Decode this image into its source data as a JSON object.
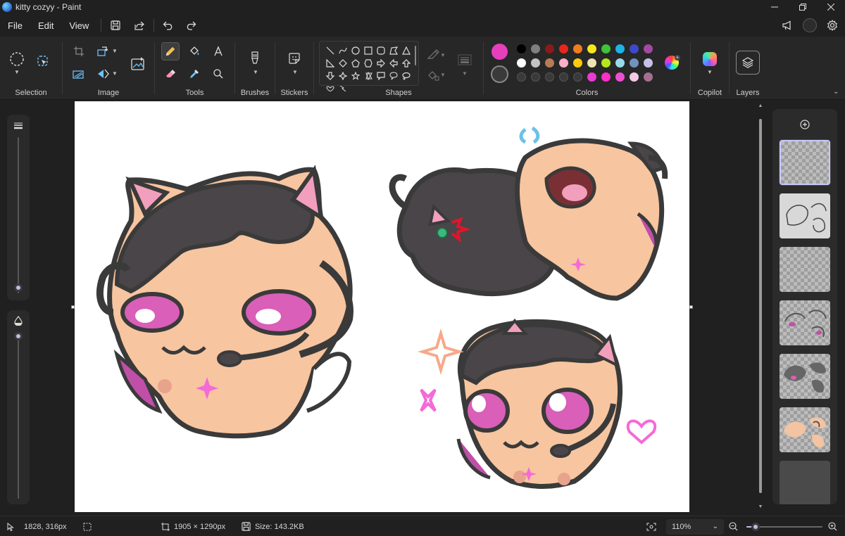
{
  "window": {
    "title": "kitty cozyy - Paint",
    "controls": [
      "minimize-icon",
      "restore-icon",
      "close-icon"
    ]
  },
  "menu": {
    "items": [
      "File",
      "Edit",
      "View"
    ],
    "quick_actions": [
      "save-icon",
      "share-icon",
      "undo-icon",
      "redo-icon"
    ],
    "right_icons": [
      "megaphone-icon",
      "account-avatar",
      "settings-icon"
    ]
  },
  "ribbon": {
    "groups": {
      "selection": "Selection",
      "image": "Image",
      "tools": "Tools",
      "brushes": "Brushes",
      "stickers": "Stickers",
      "shapes": "Shapes",
      "colors": "Colors",
      "copilot": "Copilot",
      "layers": "Layers"
    },
    "active_tool": "pencil",
    "colors": {
      "primary": "#e63fbe",
      "secondary": "#3a3a3a",
      "palette": [
        [
          "#000000",
          "#7f7f7f",
          "#8b1a1a",
          "#e8261c",
          "#f07d1c",
          "#f5e71c",
          "#3cc43a",
          "#1cb3e6",
          "#3f48cc",
          "#a349a4"
        ],
        [
          "#ffffff",
          "#c3c3c3",
          "#b97a57",
          "#ffadc9",
          "#ffc90e",
          "#efe4b0",
          "#b5e61d",
          "#99d9ea",
          "#7092be",
          "#c8bfe7"
        ],
        [
          "#3a3a3a",
          "#3a3a3a",
          "#3a3a3a",
          "#3a3a3a",
          "#3a3a3a",
          "#ea3bd2",
          "#ff2fc8",
          "#ec4fd0",
          "#f4c8e8",
          "#a66f8f"
        ]
      ]
    }
  },
  "status": {
    "cursor_position": "1828, 316px",
    "canvas_size": "1905 × 1290px",
    "file_size": "Size: 143.2KB",
    "zoom": "110%",
    "zoom_fraction": 0.12
  },
  "layers": {
    "count": 7,
    "selected_index": 0
  }
}
